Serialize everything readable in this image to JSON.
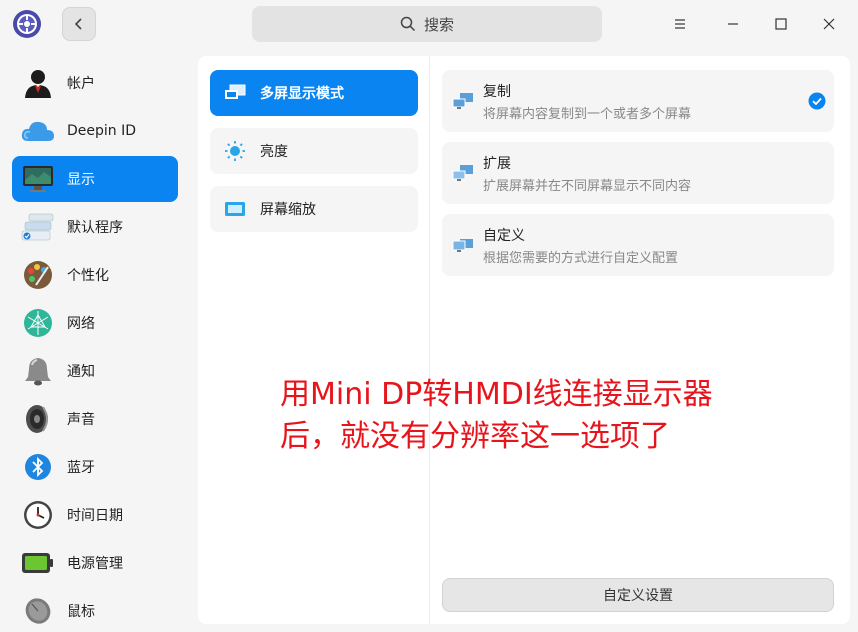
{
  "titlebar": {
    "search_label": "搜索"
  },
  "icons": {
    "app": "gear-icon",
    "back": "chevron-left-icon",
    "search": "search-icon",
    "menu": "menu-icon",
    "minimize": "minimize-icon",
    "maximize": "maximize-icon",
    "close": "close-icon"
  },
  "sidebar": {
    "items": [
      {
        "label": "帐户",
        "icon": "user-icon"
      },
      {
        "label": "Deepin ID",
        "icon": "cloud-icon"
      },
      {
        "label": "显示",
        "icon": "monitor-icon",
        "active": true
      },
      {
        "label": "默认程序",
        "icon": "default-apps-icon"
      },
      {
        "label": "个性化",
        "icon": "palette-icon"
      },
      {
        "label": "网络",
        "icon": "network-icon"
      },
      {
        "label": "通知",
        "icon": "bell-icon"
      },
      {
        "label": "声音",
        "icon": "speaker-icon"
      },
      {
        "label": "蓝牙",
        "icon": "bluetooth-icon"
      },
      {
        "label": "时间日期",
        "icon": "clock-icon"
      },
      {
        "label": "电源管理",
        "icon": "battery-icon"
      },
      {
        "label": "鼠标",
        "icon": "mouse-icon"
      }
    ]
  },
  "subnav": {
    "items": [
      {
        "label": "多屏显示模式",
        "icon": "multi-screen-icon",
        "active": true
      },
      {
        "label": "亮度",
        "icon": "brightness-icon"
      },
      {
        "label": "屏幕缩放",
        "icon": "scale-icon"
      }
    ]
  },
  "options": [
    {
      "title": "复制",
      "desc": "将屏幕内容复制到一个或者多个屏幕",
      "selected": true
    },
    {
      "title": "扩展",
      "desc": "扩展屏幕并在不同屏幕显示不同内容",
      "selected": false
    },
    {
      "title": "自定义",
      "desc": "根据您需要的方式进行自定义配置",
      "selected": false
    }
  ],
  "annotation": "用Mini DP转HMDI线连接显示器后，就没有分辨率这一选项了",
  "custom_button_label": "自定义设置",
  "colors": {
    "accent": "#0a84f0",
    "annotation": "#e8141c"
  }
}
